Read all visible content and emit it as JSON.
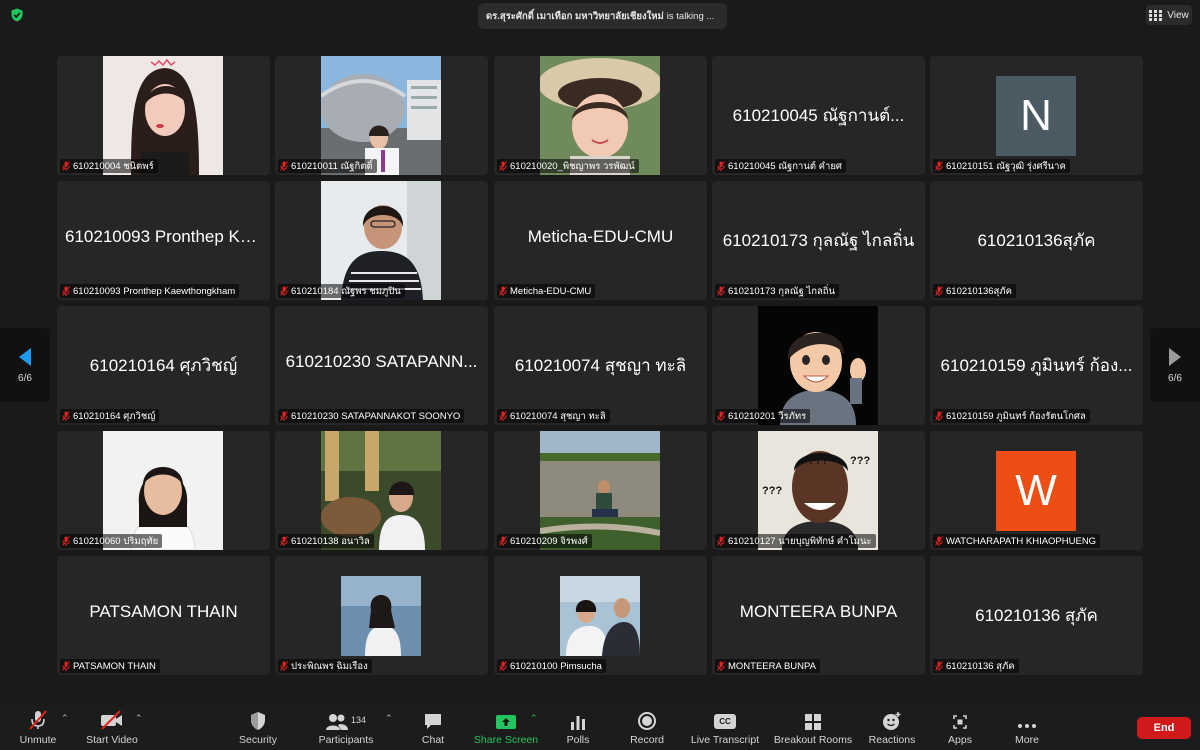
{
  "top": {
    "speaker_name": "ดร.สุระศักดิ์ เมาเทือก มหาวิทยาลัยเชียงใหม่",
    "speaker_suffix": "is talking ...",
    "view_label": "View"
  },
  "nav": {
    "left_page": "6/6",
    "right_page": "6/6"
  },
  "tiles": [
    {
      "label": "610210004 ชนิตพร์"
    },
    {
      "label": "610210011 ณัฐกิตติ์"
    },
    {
      "label": "610210020_พิชญาพร วรพัฒน์"
    },
    {
      "label": "610210045 ณัฐกานต์ คำยศ",
      "center": "610210045 ณัฐกานต์..."
    },
    {
      "label": "610210151 ณัฐวุฒิ รุ่งศรีนาค",
      "letter": "N"
    },
    {
      "label": "610210093 Pronthep Kaewthongkham",
      "center": "610210093 Pronthep Ka..."
    },
    {
      "label": "610210184 ณัฐพร ชมภูปิน"
    },
    {
      "label": "Meticha-EDU-CMU",
      "center": "Meticha-EDU-CMU"
    },
    {
      "label": "610210173 กุลณัฐ ไกลถิ่น",
      "center": "610210173 กุลณัฐ ไกลถิ่น"
    },
    {
      "label": "610210136สุภัค",
      "center": "610210136สุภัค"
    },
    {
      "label": "610210164 ศุภวิชญ์",
      "center": "610210164 ศุภวิชญ์"
    },
    {
      "label": "610210230 SATAPANNAKOT SOONYO",
      "center": "610210230 SATAPANN..."
    },
    {
      "label": "610210074 สุชญา ทะลิ",
      "center": "610210074 สุชญา ทะลิ"
    },
    {
      "label": "610210201 วีรภัทร"
    },
    {
      "label": "610210159 ภูมินทร์ ก้องรัตนโกศล",
      "center": "610210159 ภูมินทร์ ก้อง..."
    },
    {
      "label": "610210060 ปริมฤทัย"
    },
    {
      "label": "610210138 อนาวิล"
    },
    {
      "label": "610210209 จิรพงศ์"
    },
    {
      "label": "610210127 นายบุญพิทักษ์ คำโมนะ",
      "overlay": "???"
    },
    {
      "label": "WATCHARAPATH KHIAOPHUENG",
      "letter": "W"
    },
    {
      "label": "PATSAMON THAIN",
      "center": "PATSAMON THAIN"
    },
    {
      "label": "ประพิณพร ฉิมเรือง"
    },
    {
      "label": "610210100 Pimsucha"
    },
    {
      "label": "MONTEERA BUNPA",
      "center": "MONTEERA BUNPA"
    },
    {
      "label": "610210136 สุภัค",
      "center": "610210136 สุภัค"
    }
  ],
  "toolbar": {
    "unmute": "Unmute",
    "start_video": "Start Video",
    "security": "Security",
    "participants": "Participants",
    "participants_count": "134",
    "chat": "Chat",
    "share_screen": "Share Screen",
    "polls": "Polls",
    "record": "Record",
    "live_transcript": "Live Transcript",
    "breakout_rooms": "Breakout Rooms",
    "reactions": "Reactions",
    "apps": "Apps",
    "more": "More",
    "end": "End",
    "cc_text": "CC"
  },
  "colors": {
    "accent_green": "#22c55e",
    "end_red": "#d1191c",
    "mic_red": "#e02424",
    "avatar_n": "#4b5a63",
    "avatar_w": "#ec4e14",
    "nav_arrow_blue": "#1e9bf0"
  }
}
